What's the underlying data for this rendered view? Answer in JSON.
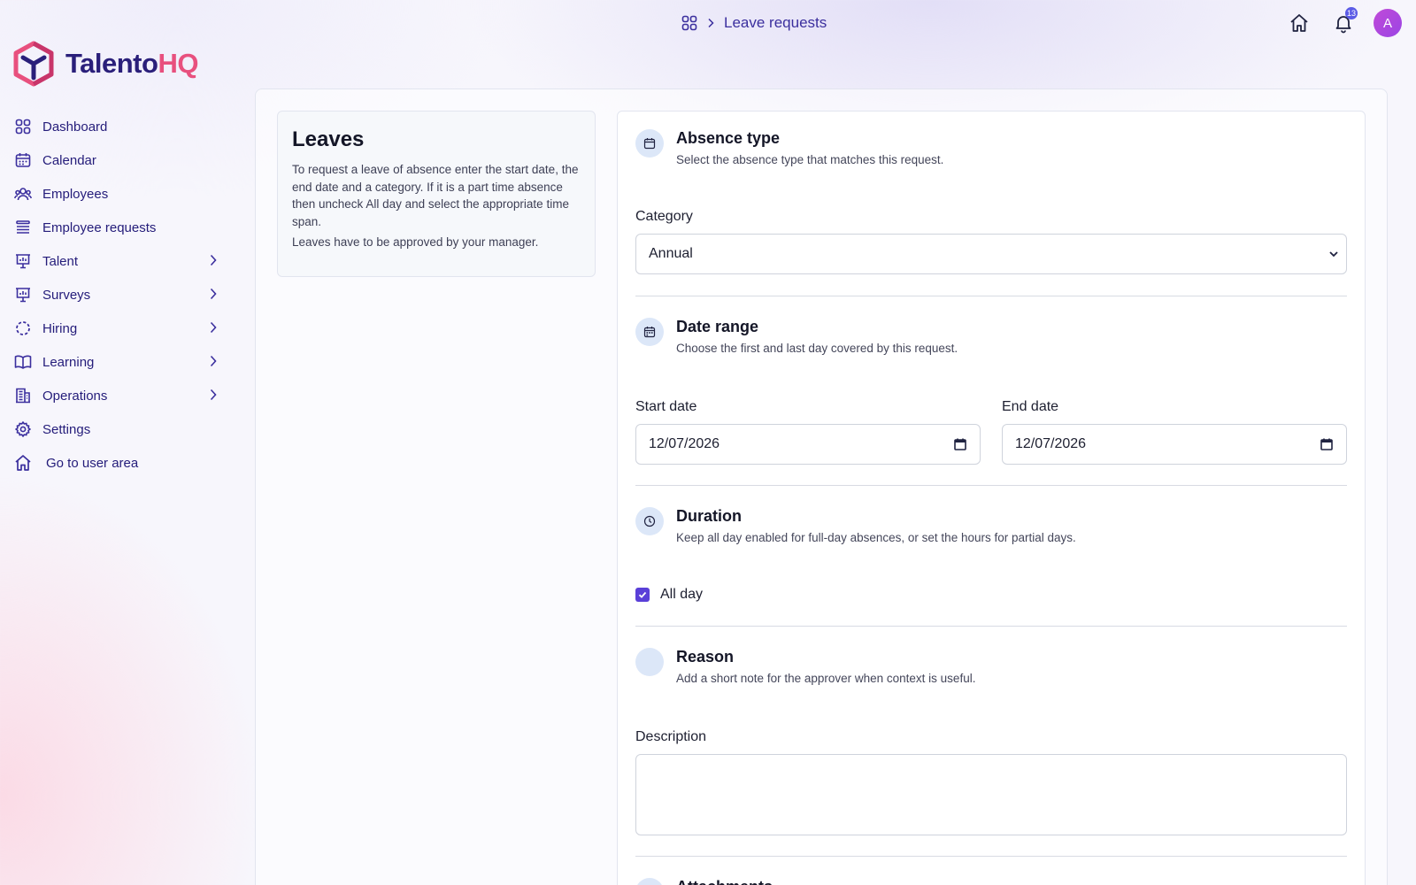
{
  "topbar": {
    "breadcrumb_label": "Leave requests",
    "notification_count": "13",
    "avatar_initial": "A"
  },
  "brand": {
    "name_part1": "Talento",
    "name_part2": "HQ",
    "colors": {
      "primary": "#2a1f7a",
      "accent": "#e8507e"
    }
  },
  "sidebar": {
    "items": [
      {
        "label": "Dashboard",
        "icon": "dashboard-grid-icon",
        "has_submenu": false
      },
      {
        "label": "Calendar",
        "icon": "calendar-icon",
        "has_submenu": false
      },
      {
        "label": "Employees",
        "icon": "employees-icon",
        "has_submenu": false
      },
      {
        "label": "Employee requests",
        "icon": "list-icon",
        "has_submenu": false
      },
      {
        "label": "Talent",
        "icon": "presentation-icon",
        "has_submenu": true
      },
      {
        "label": "Surveys",
        "icon": "presentation-icon",
        "has_submenu": true
      },
      {
        "label": "Hiring",
        "icon": "dashed-circle-icon",
        "has_submenu": true
      },
      {
        "label": "Learning",
        "icon": "book-icon",
        "has_submenu": true
      },
      {
        "label": "Operations",
        "icon": "building-icon",
        "has_submenu": true
      },
      {
        "label": "Settings",
        "icon": "gear-icon",
        "has_submenu": false
      },
      {
        "label": "Go to user area",
        "icon": "home-icon",
        "has_submenu": false
      }
    ]
  },
  "info": {
    "title": "Leaves",
    "text1": "To request a leave of absence enter the start date, the end date and a category. If it is a part time absence then uncheck All day and select the appropriate time span.",
    "text2": "Leaves have to be approved by your manager."
  },
  "form": {
    "absence_type": {
      "title": "Absence type",
      "description": "Select the absence type that matches this request."
    },
    "category": {
      "label": "Category",
      "value": "Annual"
    },
    "date_range": {
      "title": "Date range",
      "description": "Choose the first and last day covered by this request."
    },
    "start_date": {
      "label": "Start date",
      "value": "12/07/2026"
    },
    "end_date": {
      "label": "End date",
      "value": "12/07/2026"
    },
    "duration": {
      "title": "Duration",
      "description": "Keep all day enabled for full-day absences, or set the hours for partial days."
    },
    "all_day": {
      "label": "All day",
      "checked": true
    },
    "reason": {
      "title": "Reason",
      "description": "Add a short note for the approver when context is useful."
    },
    "description_field": {
      "label": "Description",
      "value": ""
    },
    "attachments": {
      "title": "Attachments"
    }
  }
}
